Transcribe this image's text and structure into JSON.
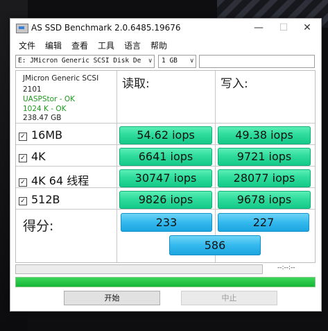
{
  "window": {
    "title": "AS SSD Benchmark 2.0.6485.19676",
    "minimize": "—",
    "maximize": "☐",
    "close": "✕"
  },
  "menu": [
    "文件",
    "编辑",
    "查看",
    "工具",
    "语言",
    "帮助"
  ],
  "drive_select": {
    "value": "E: JMicron Generic SCSI Disk Devi",
    "arrow": "∨"
  },
  "size_select": {
    "value": "1 GB",
    "arrow": "∨"
  },
  "device_info": {
    "name": "JMicron Generic SCSI",
    "firmware": "2101",
    "driver_status": "UASPStor - OK",
    "alignment_status": "1024 K - OK",
    "capacity": "238.47 GB"
  },
  "colors": {
    "driver_status": "#1f9a1f",
    "alignment_status": "#1f9a1f",
    "result_green": "#2fdc9c",
    "score_blue": "#34b9ee"
  },
  "columns": {
    "read": "读取:",
    "write": "写入:"
  },
  "rows": [
    {
      "label": "16MB",
      "checked": true,
      "read": "54.62 iops",
      "write": "49.38 iops"
    },
    {
      "label": "4K",
      "checked": true,
      "read": "6641 iops",
      "write": "9721 iops"
    },
    {
      "label": "4K 64 线程",
      "checked": true,
      "read": "30747 iops",
      "write": "28077 iops"
    },
    {
      "label": "512B",
      "checked": true,
      "read": "9826 iops",
      "write": "9678 iops"
    }
  ],
  "score": {
    "label": "得分:",
    "read": "233",
    "write": "227",
    "total": "586"
  },
  "progress": {
    "time": "--:--:--",
    "main_fraction": 1.0
  },
  "buttons": {
    "start": "开始",
    "stop": "中止"
  }
}
